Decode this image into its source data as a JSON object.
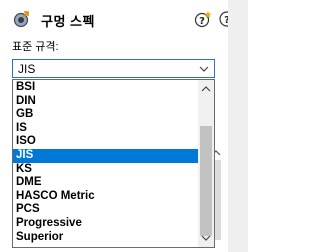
{
  "header": {
    "title": "구멍 스펙",
    "icon": "hole-wizard-icon",
    "help_icons": [
      "help-tips-icon",
      "help-icon"
    ]
  },
  "standard": {
    "label": "표준 규격:",
    "selected": "JIS",
    "options": [
      "BSI",
      "DIN",
      "GB",
      "IS",
      "ISO",
      "JIS",
      "KS",
      "DME",
      "HASCO Metric",
      "PCS",
      "Progressive",
      "Superior"
    ],
    "selected_index": 5
  },
  "colors": {
    "selection": "#0078d7",
    "focus_border": "#2b6fd4",
    "panel_bg": "#ffffff",
    "side_bg": "#efefef"
  }
}
